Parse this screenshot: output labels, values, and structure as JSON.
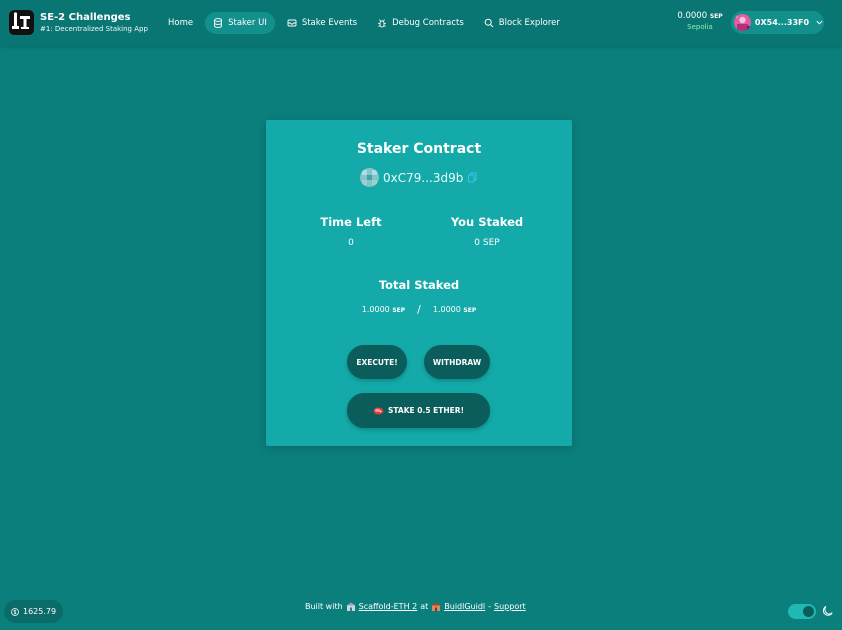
{
  "header": {
    "brand_title": "SE-2 Challenges",
    "brand_subtitle": "#1: Decentralized Staking App",
    "nav": [
      {
        "label": "Home",
        "icon": "none",
        "active": false
      },
      {
        "label": "Staker UI",
        "icon": "database-icon",
        "active": true
      },
      {
        "label": "Stake Events",
        "icon": "inbox-stack-icon",
        "active": false
      },
      {
        "label": "Debug Contracts",
        "icon": "bug-icon",
        "active": false
      },
      {
        "label": "Block Explorer",
        "icon": "search-icon",
        "active": false
      }
    ],
    "balance_value": "0.0000",
    "balance_unit": "SEP",
    "network": "Sepolia",
    "account_address": "0X54...33F0"
  },
  "card": {
    "title": "Staker Contract",
    "contract_address": "0xC79...3d9b",
    "time_left_label": "Time Left",
    "time_left_value": "0",
    "you_staked_label": "You Staked",
    "you_staked_value": "0 SEP",
    "total_staked_label": "Total Staked",
    "total_staked_value": "1.0000",
    "total_staked_unit": "SEP",
    "threshold_value": "1.0000",
    "threshold_unit": "SEP",
    "separator": "/",
    "execute_label": "EXECUTE!",
    "withdraw_label": "WITHDRAW",
    "stake_label": "STAKE 0.5 ETHER!"
  },
  "footer": {
    "eth_price": "1625.79",
    "built_with": "Built with",
    "scaffold_link": "Scaffold-ETH 2",
    "at": "at",
    "buidlguidl_link": "BuidlGuidl",
    "dash": "-",
    "support_link": "Support",
    "dark_mode": true
  },
  "colors": {
    "background": "#0b7f7c",
    "header": "#0a7673",
    "card": "#13aaa9",
    "button": "#0a5d5a",
    "network": "#86efac"
  }
}
